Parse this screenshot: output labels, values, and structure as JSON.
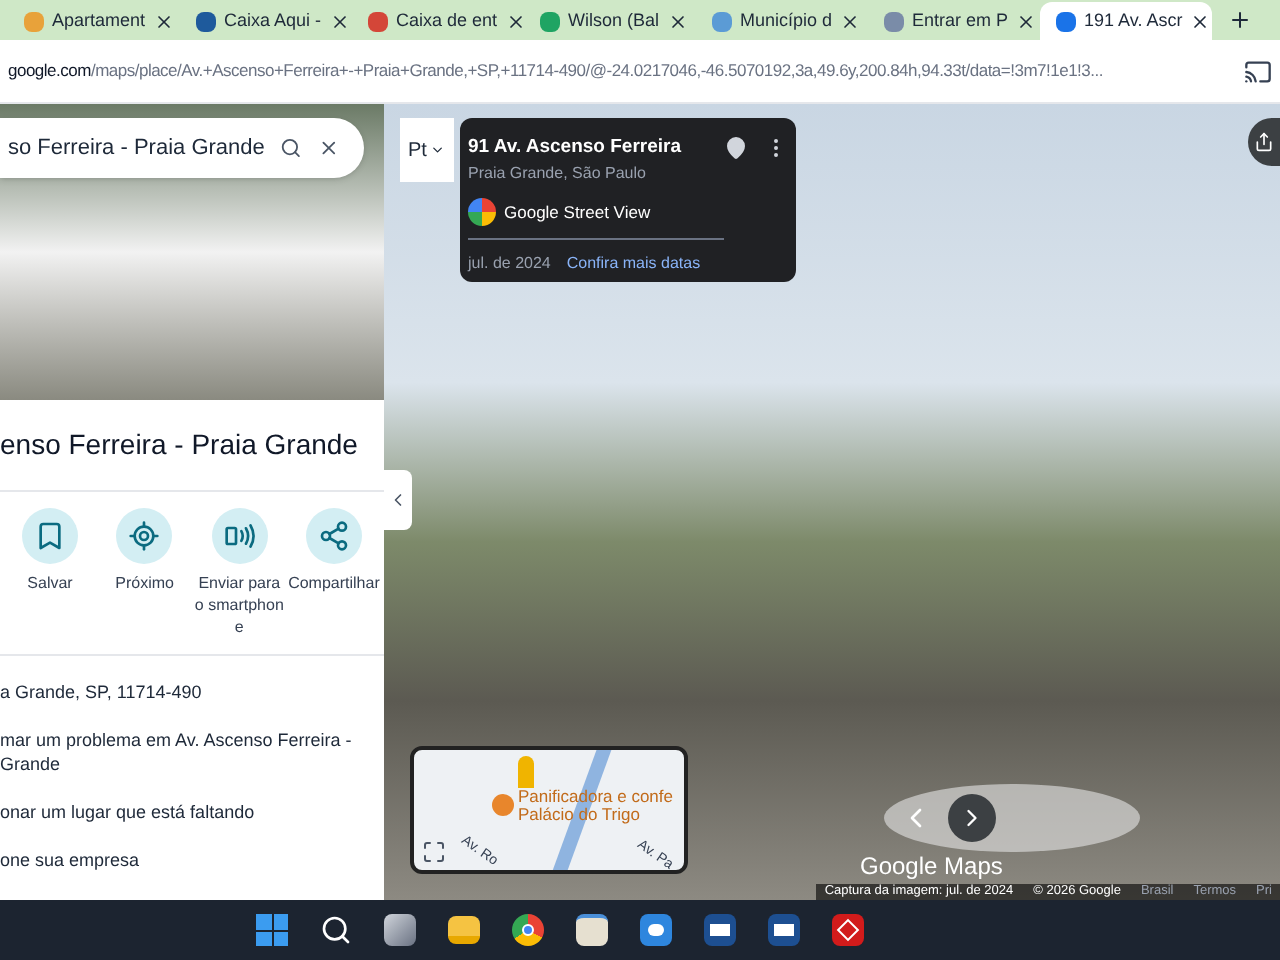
{
  "tabs": [
    {
      "label": "Apartament",
      "selected": false,
      "color": "#e8a23a"
    },
    {
      "label": "Caixa Aqui -",
      "selected": false,
      "color": "#1e5a9c"
    },
    {
      "label": "Caixa de ent",
      "selected": false,
      "color": "#d44638"
    },
    {
      "label": "Wilson (Bal",
      "selected": false,
      "color": "#1fa463"
    },
    {
      "label": "Município d",
      "selected": false,
      "color": "#5b9bd5"
    },
    {
      "label": "Entrar em P",
      "selected": false,
      "color": "#7a8ca8"
    },
    {
      "label": "191 Av. Ascr",
      "selected": true,
      "color": "#1a73e8"
    }
  ],
  "address": {
    "host": "google.com",
    "path": "/maps/place/Av.+Ascenso+Ferreira+-+Praia+Grande,+SP,+11714-490/@-24.0217046,-46.5070192,3a,49.6y,200.84h,94.33t/data=!3m7!1e1!3..."
  },
  "sidebar": {
    "search_value": "so Ferreira - Praia Grande",
    "title": "enso Ferreira - Praia Grande",
    "actions": [
      {
        "label": "Salvar",
        "kind": "bookmark"
      },
      {
        "label": "Próximo",
        "kind": "nearby"
      },
      {
        "label": "Enviar para o smartphone",
        "kind": "phone"
      },
      {
        "label": "Compartilhar",
        "kind": "share"
      }
    ],
    "items": [
      "a Grande, SP, 11714-490",
      "mar um problema em Av. Ascenso Ferreira - Grande",
      "onar um lugar que está faltando",
      "one sua empresa"
    ]
  },
  "street_view": {
    "pt_label": "Pt",
    "card": {
      "title": "91 Av. Ascenso Ferreira",
      "subtitle": "Praia Grande, São Paulo",
      "source": "Google Street View",
      "date": "jul. de 2024",
      "link": "Confira mais datas"
    },
    "minimap": {
      "place_lines": [
        "Panificadora e confe",
        "Palácio do Trigo"
      ],
      "street_labels": [
        "Av. Ro",
        "Av. Pa"
      ]
    },
    "brand": "Google Maps",
    "footer": [
      "Captura da imagem: jul. de 2024",
      "© 2026 Google",
      "Brasil",
      "Termos",
      "Pri"
    ]
  },
  "taskbar": [
    {
      "kind": "windows"
    },
    {
      "kind": "search"
    },
    {
      "kind": "taskview"
    },
    {
      "kind": "folder"
    },
    {
      "kind": "chrome"
    },
    {
      "kind": "store"
    },
    {
      "kind": "app"
    },
    {
      "kind": "doc"
    },
    {
      "kind": "doc"
    },
    {
      "kind": "pdf"
    }
  ]
}
